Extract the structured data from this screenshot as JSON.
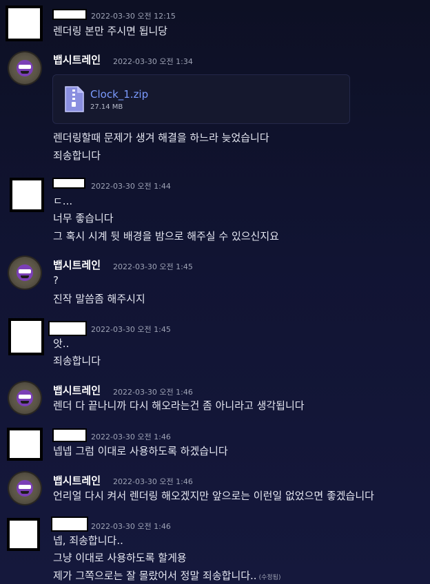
{
  "messages": [
    {
      "author": "",
      "timestamp": "2022-03-30 오전 12:15",
      "lines": [
        "렌더링 본만 주시면 됩니당"
      ]
    },
    {
      "author": "뱁시트레인",
      "timestamp": "2022-03-30 오전 1:34",
      "attachment": {
        "name": "Clock_1.zip",
        "size": "27.14 MB",
        "icon": "zip-file-icon"
      },
      "lines": [
        "렌더링할때 문제가 생겨 해결을 하느라 늦었습니다",
        "죄송합니다"
      ]
    },
    {
      "author": "",
      "timestamp": "2022-03-30 오전 1:44",
      "lines": [
        "ㄷ...",
        "너무 좋습니다",
        "그 혹시 시계 뒷 배경을 밤으로 해주실 수 있으신지요"
      ]
    },
    {
      "author": "뱁시트레인",
      "timestamp": "2022-03-30 오전 1:45",
      "lines": [
        "?",
        "진작 말씀좀 해주시지"
      ]
    },
    {
      "author": "",
      "timestamp": "2022-03-30 오전 1:45",
      "lines": [
        "앗..",
        "죄송합니다"
      ]
    },
    {
      "author": "뱁시트레인",
      "timestamp": "2022-03-30 오전 1:46",
      "lines": [
        "렌더 다 끝나니까 다시 해오라는건 좀 아니라고 생각됩니다"
      ]
    },
    {
      "author": "",
      "timestamp": "2022-03-30 오전 1:46",
      "lines": [
        "넵넵 그럼 이대로 사용하도록 하겠습니다"
      ]
    },
    {
      "author": "뱁시트레인",
      "timestamp": "2022-03-30 오전 1:46",
      "lines": [
        "언리얼 다시 켜서 렌더링 해오겠지만 앞으로는 이런일 없었으면 좋겠습니다"
      ]
    },
    {
      "author": "",
      "timestamp": "2022-03-30 오전 1:46",
      "lines": [
        "넵, 죄송합니다..",
        "그냥 이대로 사용하도록 할게용",
        "제가 그쪽으로는 잘 몰랐어서 정말 죄송합니다.."
      ],
      "edited": "(수정됨)"
    }
  ],
  "colors": {
    "background": "#111433",
    "link": "#7c9bff",
    "timestamp": "#9ea3b5"
  }
}
